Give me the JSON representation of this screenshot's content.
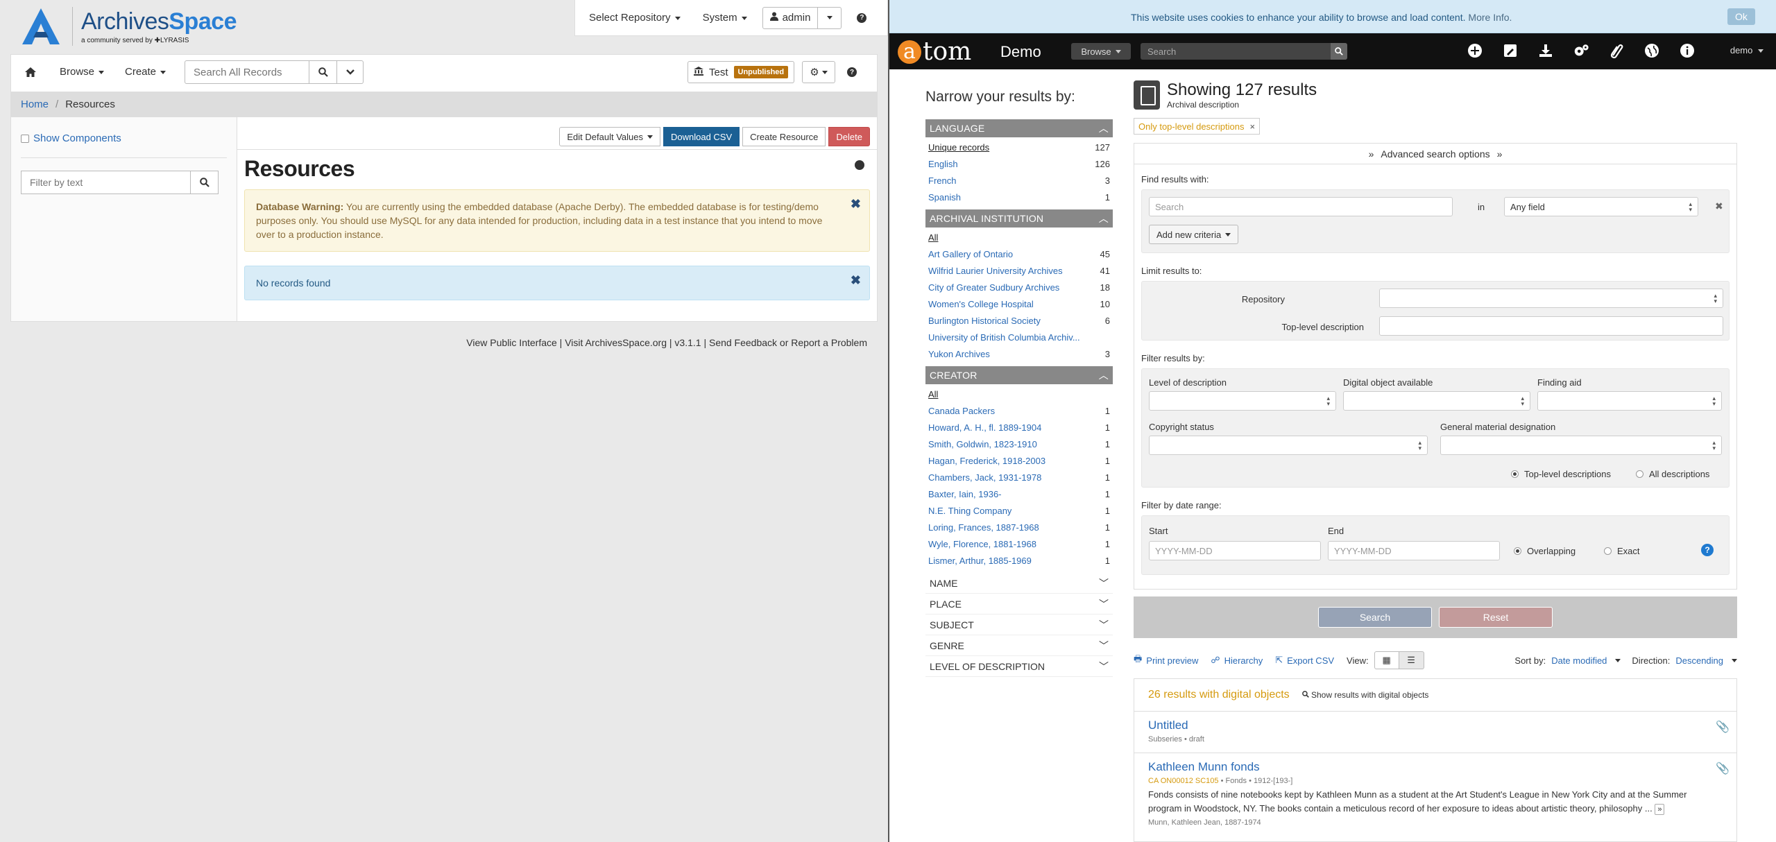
{
  "archivesspace": {
    "logo": {
      "name_part1": "Archives",
      "name_part2": "Space",
      "tagline": "a community served by ✚LYRASIS"
    },
    "topnav": {
      "select_repository": "Select Repository",
      "system": "System",
      "user": "admin"
    },
    "mainbar": {
      "browse": "Browse",
      "create": "Create",
      "search_placeholder": "Search All Records",
      "repo_name": "Test",
      "repo_badge": "Unpublished"
    },
    "breadcrumb": {
      "home": "Home",
      "sep": "/",
      "current": "Resources"
    },
    "sidebar": {
      "show_components": "Show Components",
      "filter_placeholder": "Filter by text"
    },
    "actions": {
      "edit_defaults": "Edit Default Values",
      "download_csv": "Download CSV",
      "create_resource": "Create Resource",
      "delete": "Delete"
    },
    "title": "Resources",
    "warning": {
      "label": "Database Warning:",
      "text": "You are currently using the embedded database (Apache Derby). The embedded database is for testing/demo purposes only. You should use MySQL for any data intended for production, including data in a test instance that you intend to move over to a production instance."
    },
    "info": "No records found",
    "footer": "View Public Interface | Visit ArchivesSpace.org | v3.1.1 | Send Feedback or Report a Problem"
  },
  "atom": {
    "cookie": {
      "message": "This website uses cookies to enhance your ability to browse and load content.",
      "more": "More Info.",
      "ok": "Ok"
    },
    "navbar": {
      "logo": "tom",
      "logo_letter": "a",
      "site": "Demo",
      "browse": "Browse",
      "search_placeholder": "Search",
      "user": "demo"
    },
    "narrow_title": "Narrow your results by:",
    "facets": {
      "language": {
        "title": "LANGUAGE",
        "items": [
          {
            "label": "Unique records",
            "count": "127"
          },
          {
            "label": "English",
            "count": "126"
          },
          {
            "label": "French",
            "count": "3"
          },
          {
            "label": "Spanish",
            "count": "1"
          }
        ]
      },
      "institution": {
        "title": "ARCHIVAL INSTITUTION",
        "all": "All",
        "items": [
          {
            "label": "Art Gallery of Ontario",
            "count": "45"
          },
          {
            "label": "Wilfrid Laurier University Archives",
            "count": "41"
          },
          {
            "label": "City of Greater Sudbury Archives",
            "count": "18"
          },
          {
            "label": "Women's College Hospital",
            "count": "10"
          },
          {
            "label": "Burlington Historical Society",
            "count": "6"
          },
          {
            "label": "University of British Columbia Archiv...",
            "count": ""
          },
          {
            "label": "Yukon Archives",
            "count": "3"
          }
        ]
      },
      "creator": {
        "title": "CREATOR",
        "all": "All",
        "items": [
          {
            "label": "Canada Packers",
            "count": "1"
          },
          {
            "label": "Howard, A. H., fl. 1889-1904",
            "count": "1"
          },
          {
            "label": "Smith, Goldwin, 1823-1910",
            "count": "1"
          },
          {
            "label": "Hagan, Frederick, 1918-2003",
            "count": "1"
          },
          {
            "label": "Chambers, Jack, 1931-1978",
            "count": "1"
          },
          {
            "label": "Baxter, Iain, 1936-",
            "count": "1"
          },
          {
            "label": "N.E. Thing Company",
            "count": "1"
          },
          {
            "label": "Loring, Frances, 1887-1968",
            "count": "1"
          },
          {
            "label": "Wyle, Florence, 1881-1968",
            "count": "1"
          },
          {
            "label": "Lismer, Arthur, 1885-1969",
            "count": "1"
          }
        ]
      },
      "collapsed": [
        "NAME",
        "PLACE",
        "SUBJECT",
        "GENRE",
        "LEVEL OF DESCRIPTION"
      ]
    },
    "results": {
      "title": "Showing 127 results",
      "subtitle": "Archival description",
      "filter_tag": "Only top-level descriptions"
    },
    "advanced": {
      "toggle": "Advanced search options",
      "find_label": "Find results with:",
      "search_placeholder": "Search",
      "in": "in",
      "field": "Any field",
      "add_criteria": "Add new criteria",
      "limit_label": "Limit results to:",
      "repository": "Repository",
      "top_level": "Top-level description",
      "filter_label": "Filter results by:",
      "level": "Level of description",
      "digital": "Digital object available",
      "finding_aid": "Finding aid",
      "copyright": "Copyright status",
      "gmd": "General material designation",
      "radio_top": "Top-level descriptions",
      "radio_all": "All descriptions",
      "date_label": "Filter by date range:",
      "start": "Start",
      "end": "End",
      "date_placeholder": "YYYY-MM-DD",
      "overlapping": "Overlapping",
      "exact": "Exact",
      "search_btn": "Search",
      "reset_btn": "Reset"
    },
    "toolbar": {
      "print": "Print preview",
      "hierarchy": "Hierarchy",
      "export": "Export CSV",
      "view": "View:",
      "sort_by": "Sort by:",
      "sort_value": "Date modified",
      "direction": "Direction:",
      "direction_value": "Descending"
    },
    "digital": {
      "count_text": "26 results with digital objects",
      "show": "Show results with digital objects"
    },
    "records": [
      {
        "title": "Untitled",
        "meta": "Subseries • draft",
        "ref": "",
        "desc": ""
      },
      {
        "title": "Kathleen Munn fonds",
        "ref": "CA ON00012 SC105",
        "meta": " • Fonds • 1912-[193-]",
        "desc": "Fonds consists of nine notebooks kept by Kathleen Munn as a student at the Art Student's League in New York City and at the Summer program in Woodstock, NY. The books contain a meticulous record of her exposure to ideas about artistic theory, philosophy ...",
        "creator": "Munn, Kathleen Jean, 1887-1974"
      }
    ]
  }
}
